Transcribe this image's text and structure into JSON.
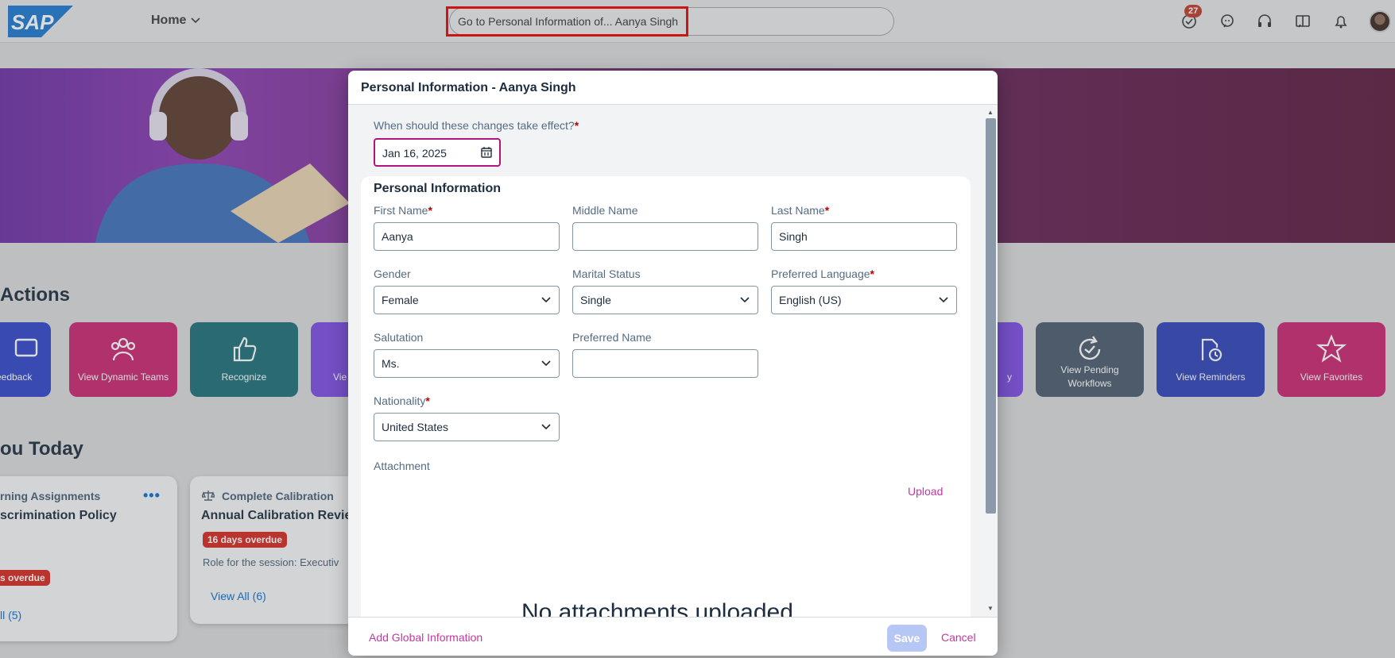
{
  "shell": {
    "logo_text": "SAP",
    "home_label": "Home",
    "search_text": "Go to Personal Information of...  Aanya Singh",
    "notification_count": "27"
  },
  "background": {
    "quick_actions_title": "Actions",
    "for_you_title": "ou Today",
    "tiles": [
      {
        "label": "Feedback",
        "color": "#3046c8",
        "icon": "feedback-icon"
      },
      {
        "label": "View Dynamic Teams",
        "color": "#c8246f",
        "icon": "team-icon"
      },
      {
        "label": "Recognize",
        "color": "#1d6f78",
        "icon": "thumbs-up-icon"
      },
      {
        "label": "Vie",
        "color": "#7b4be0",
        "icon": "view-icon"
      },
      {
        "label": "y",
        "color": "#7b4be0",
        "icon": "view-icon"
      },
      {
        "label": "View Pending Workflows",
        "color": "#4a5a6c",
        "icon": "refresh-icon"
      },
      {
        "label": "View Reminders",
        "color": "#2d42b8",
        "icon": "reminder-icon"
      },
      {
        "label": "View Favorites",
        "color": "#c8246f",
        "icon": "star-icon"
      }
    ],
    "card1": {
      "type": "rning Assignments",
      "title": "scrimination Policy",
      "overdue": "s overdue",
      "view_all": "ll (5)"
    },
    "card2": {
      "type": "Complete Calibration",
      "title": "Annual Calibration Revie",
      "overdue": "16 days overdue",
      "description": "Role for the session: Executiv",
      "view_all": "View All (6)"
    }
  },
  "dialog": {
    "title": "Personal Information - Aanya Singh",
    "effective_label": "When should these changes take effect?",
    "effective_date": "Jan 16, 2025",
    "section_title": "Personal Information",
    "fields": {
      "first_name": {
        "label": "First Name",
        "value": "Aanya",
        "required": "*"
      },
      "middle_name": {
        "label": "Middle Name",
        "value": ""
      },
      "last_name": {
        "label": "Last Name",
        "value": "Singh",
        "required": "*"
      },
      "gender": {
        "label": "Gender",
        "value": "Female"
      },
      "marital_status": {
        "label": "Marital Status",
        "value": "Single"
      },
      "preferred_language": {
        "label": "Preferred Language",
        "value": "English (US)",
        "required": "*"
      },
      "salutation": {
        "label": "Salutation",
        "value": "Ms."
      },
      "preferred_name": {
        "label": "Preferred Name",
        "value": ""
      },
      "nationality": {
        "label": "Nationality",
        "value": "United States",
        "required": "*"
      }
    },
    "attachment_label": "Attachment",
    "upload_label": "Upload",
    "no_attachments_text": "No attachments uploaded",
    "footer": {
      "add_global": "Add Global Information",
      "save": "Save",
      "cancel": "Cancel"
    }
  }
}
